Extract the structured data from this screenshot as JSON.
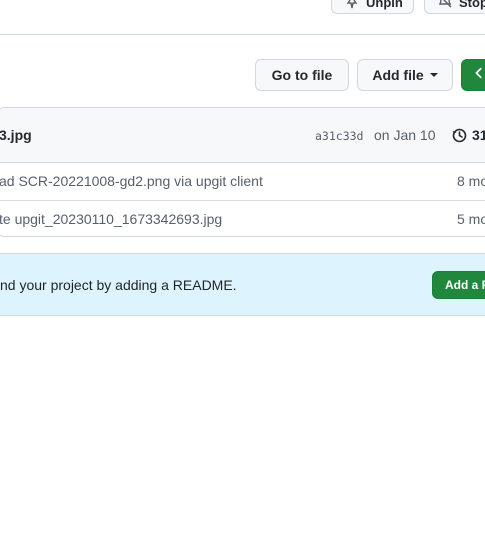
{
  "header": {
    "unpin_label": "Unpin",
    "stop_label": "Stop"
  },
  "toolbar": {
    "go_to_file": "Go to file",
    "add_file": "Add file"
  },
  "latest_commit": {
    "message": "3.jpg",
    "sha": "a31c33d",
    "date": "on Jan 10",
    "commit_count": "31"
  },
  "files": [
    {
      "message": "ad SCR-20221008-gd2.png via upgit client",
      "age": "8 mo"
    },
    {
      "message": "te upgit_20230110_1673342693.jpg",
      "age": "5 mo"
    }
  ],
  "readme_banner": {
    "text": "nd your project by adding a README.",
    "button": "Add a R"
  },
  "colors": {
    "green": "#1f883d",
    "banner_bg": "#ddf4ff",
    "border": "#d0d7de"
  }
}
